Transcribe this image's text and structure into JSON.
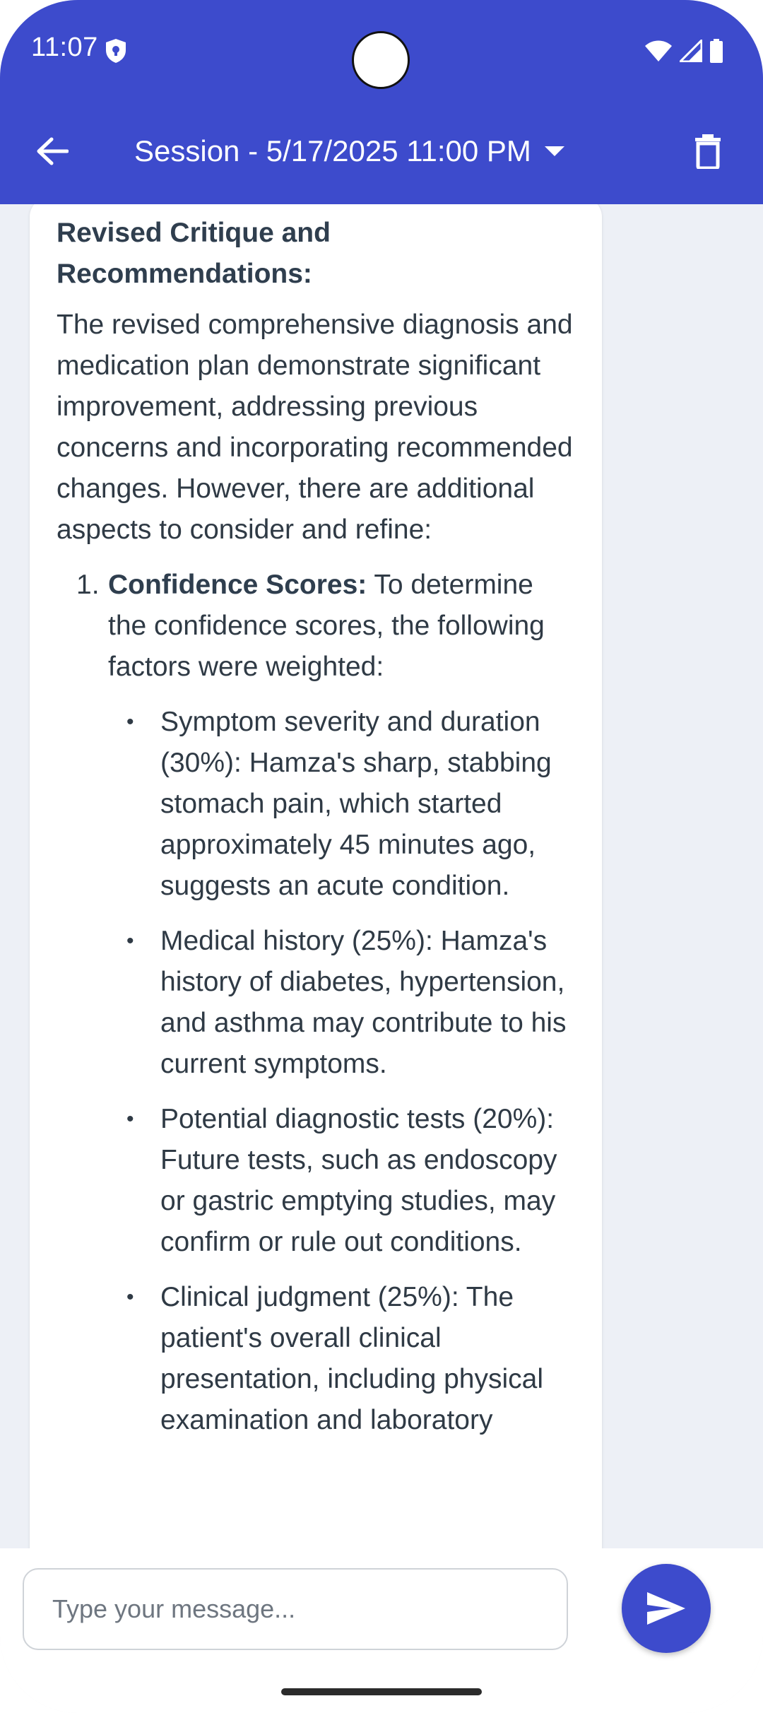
{
  "status_bar": {
    "time": "11:07",
    "icons": [
      "shield-icon",
      "wifi-icon",
      "signal-icon",
      "battery-icon"
    ]
  },
  "app_bar": {
    "title": "Session - 5/17/2025 11:00 PM",
    "background": "#3d4bcc",
    "icons": [
      "back-arrow-icon",
      "dropdown-caret-icon",
      "trash-icon"
    ]
  },
  "message": {
    "heading": "Revised Critique and Recommendations:",
    "intro": "The revised comprehensive diagnosis and medication plan demonstrate significant improvement, addressing previous concerns and incorporating recommended changes. However, there are additional aspects to consider and refine:",
    "items": [
      {
        "number": "1.",
        "title": "Confidence Scores:",
        "text": " To determine the confidence scores, the following factors were weighted:",
        "bullets": [
          "Symptom severity and duration (30%): Hamza's sharp, stabbing stomach pain, which started approximately 45 minutes ago, suggests an acute condition.",
          "Medical history (25%): Hamza's history of diabetes, hypertension, and asthma may contribute to his current symptoms.",
          "Potential diagnostic tests (20%): Future tests, such as endoscopy or gastric emptying studies, may confirm or rule out conditions.",
          "Clinical judgment (25%): The patient's overall clinical presentation, including physical examination and laboratory"
        ]
      }
    ]
  },
  "composer": {
    "placeholder": "Type your message...",
    "send_icon": "send-icon",
    "accent": "#3d4bcc"
  }
}
